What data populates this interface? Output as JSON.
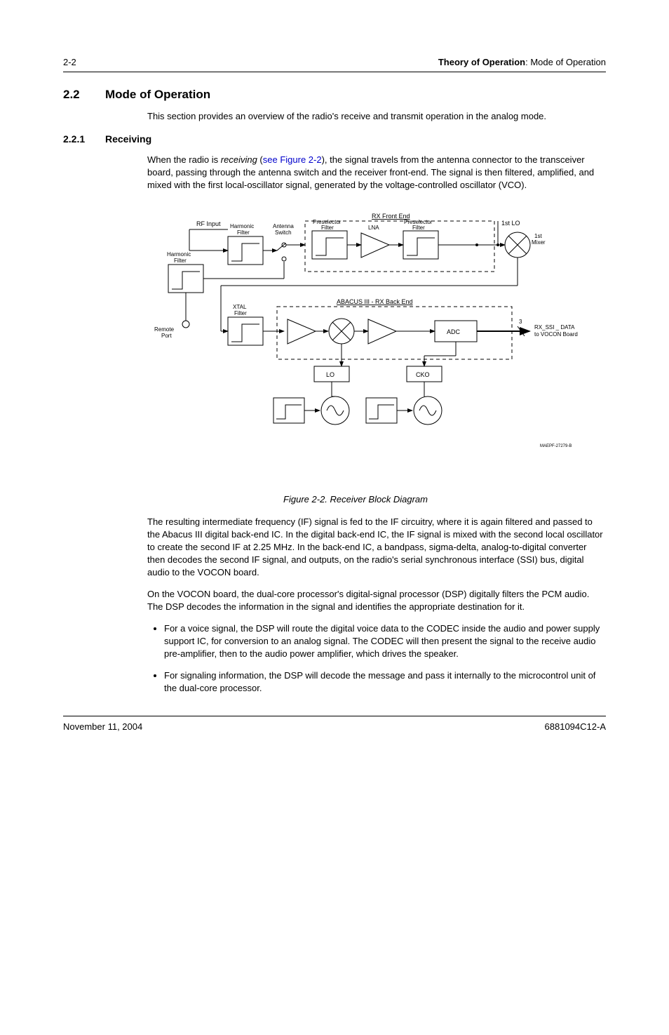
{
  "header": {
    "page_num": "2-2",
    "running_title_bold": "Theory of Operation",
    "running_title_rest": ": Mode of Operation"
  },
  "section": {
    "num": "2.2",
    "title": "Mode of Operation",
    "intro": "This section provides an overview of the radio's receive and transmit operation in the analog mode."
  },
  "subsection": {
    "num": "2.2.1",
    "title": "Receiving",
    "para_pre": "When the radio is ",
    "para_em": "receiving",
    "para_space": " (",
    "para_link": "see Figure 2-2",
    "para_post": "), the signal travels from the antenna connector to the transceiver board, passing through the antenna switch and the receiver front-end. The signal is then filtered, amplified, and mixed with the first local-oscillator signal, generated by the voltage-controlled oscillator (VCO)."
  },
  "figure": {
    "caption": "Figure 2-2.  Receiver Block Diagram",
    "labels": {
      "rf_input": "RF Input",
      "rx_front_end": "RX Front End",
      "harmonic_filter_left": "Harmonic\nFilter",
      "harmonic_filter_inner": "Harmonic\nFilter",
      "antenna_switch": "Antenna\nSwitch",
      "preselector_filter_1": "Preselector\nFilter",
      "lna": "LNA",
      "preselector_filter_2": "Preselector\nFilter",
      "first_lo": "1st LO",
      "first_mixer": "1st\nMixer",
      "remote_port": "Remote\nPort",
      "xtal_filter": "XTAL\nFilter",
      "abacus_back_end": "ABACUS III  -  RX Back End",
      "adc": "ADC",
      "lo": "LO",
      "cko": "CKO",
      "bus_count": "3",
      "rx_ssi_data": "RX_SSI _ DATA",
      "to_vocon": "to VOCON Board",
      "maepf": "MAEPF-27279-B"
    }
  },
  "after_figure": {
    "p1": "The resulting intermediate frequency (IF) signal is fed to the IF circuitry, where it is again filtered and passed to the Abacus III digital back-end IC. In the digital back-end IC, the IF signal is mixed with the second local oscillator to create the second IF at 2.25 MHz. In the back-end IC, a bandpass, sigma-delta, analog-to-digital converter then decodes the second IF signal, and outputs, on the radio's serial synchronous interface (SSI) bus, digital audio to the VOCON board.",
    "p2": "On the VOCON board, the dual-core processor's digital-signal processor (DSP) digitally filters the PCM audio. The DSP decodes the information in the signal and identifies the appropriate destination for it.",
    "bullets": [
      "For a voice signal, the DSP will route the digital voice data to the CODEC inside the audio and power supply support IC, for conversion to an analog signal. The CODEC will then present the signal to the receive audio pre-amplifier, then to the audio power amplifier, which drives the speaker.",
      "For signaling information, the DSP will decode the message and pass it internally to the microcontrol unit of the dual-core processor."
    ]
  },
  "footer": {
    "date": "November 11, 2004",
    "docnum": "6881094C12-A"
  },
  "chart_data": {
    "type": "diagram",
    "title": "Receiver Block Diagram",
    "nodes": [
      {
        "id": "rf_input",
        "label": "RF Input",
        "kind": "port"
      },
      {
        "id": "harm_filter_outer",
        "label": "Harmonic Filter",
        "kind": "filter"
      },
      {
        "id": "remote_port",
        "label": "Remote Port",
        "kind": "port"
      },
      {
        "id": "harm_filter_inner",
        "label": "Harmonic Filter",
        "kind": "filter"
      },
      {
        "id": "ant_switch",
        "label": "Antenna Switch",
        "kind": "switch"
      },
      {
        "id": "presel_1",
        "label": "Preselector Filter",
        "kind": "filter",
        "group": "RX Front End"
      },
      {
        "id": "lna",
        "label": "LNA",
        "kind": "amp",
        "group": "RX Front End"
      },
      {
        "id": "presel_2",
        "label": "Preselector Filter",
        "kind": "filter",
        "group": "RX Front End"
      },
      {
        "id": "first_lo",
        "label": "1st LO",
        "kind": "lo_input"
      },
      {
        "id": "first_mixer",
        "label": "1st Mixer",
        "kind": "mixer"
      },
      {
        "id": "xtal_filter",
        "label": "XTAL Filter",
        "kind": "filter"
      },
      {
        "id": "be_amp1",
        "label": "Amp",
        "kind": "amp",
        "group": "ABACUS III - RX Back End"
      },
      {
        "id": "be_mixer",
        "label": "Mixer",
        "kind": "mixer",
        "group": "ABACUS III - RX Back End"
      },
      {
        "id": "be_amp2",
        "label": "Amp",
        "kind": "amp",
        "group": "ABACUS III - RX Back End"
      },
      {
        "id": "adc",
        "label": "ADC",
        "kind": "adc",
        "group": "ABACUS III - RX Back End"
      },
      {
        "id": "be_lo_filter",
        "label": "Filter",
        "kind": "filter",
        "group": "ABACUS III - RX Back End"
      },
      {
        "id": "lo_osc",
        "label": "LO",
        "kind": "osc",
        "group": "ABACUS III - RX Back End"
      },
      {
        "id": "be_cko_filter",
        "label": "Filter",
        "kind": "filter",
        "group": "ABACUS III - RX Back End"
      },
      {
        "id": "cko_osc",
        "label": "CKO",
        "kind": "osc",
        "group": "ABACUS III - RX Back End"
      },
      {
        "id": "rx_ssi_out",
        "label": "RX_SSI_DATA to VOCON Board",
        "kind": "bus_out",
        "bus_width": 3
      }
    ],
    "edges": [
      [
        "rf_input",
        "harm_filter_inner"
      ],
      [
        "harm_filter_inner",
        "ant_switch"
      ],
      [
        "ant_switch",
        "presel_1"
      ],
      [
        "presel_1",
        "lna"
      ],
      [
        "lna",
        "presel_2"
      ],
      [
        "presel_2",
        "first_mixer"
      ],
      [
        "first_lo",
        "first_mixer"
      ],
      [
        "first_mixer",
        "xtal_filter"
      ],
      [
        "xtal_filter",
        "be_amp1"
      ],
      [
        "be_amp1",
        "be_mixer"
      ],
      [
        "be_mixer",
        "be_amp2"
      ],
      [
        "be_amp2",
        "adc"
      ],
      [
        "adc",
        "rx_ssi_out"
      ],
      [
        "be_lo_filter",
        "lo_osc"
      ],
      [
        "lo_osc",
        "be_mixer"
      ],
      [
        "be_cko_filter",
        "cko_osc"
      ],
      [
        "cko_osc",
        "adc"
      ],
      [
        "harm_filter_outer",
        "remote_port"
      ],
      [
        "harm_filter_outer",
        "ant_switch"
      ]
    ],
    "groups": [
      {
        "name": "RX Front End",
        "members": [
          "presel_1",
          "lna",
          "presel_2"
        ]
      },
      {
        "name": "ABACUS III - RX Back End",
        "members": [
          "be_amp1",
          "be_mixer",
          "be_amp2",
          "adc",
          "be_lo_filter",
          "lo_osc",
          "be_cko_filter",
          "cko_osc"
        ]
      }
    ]
  }
}
